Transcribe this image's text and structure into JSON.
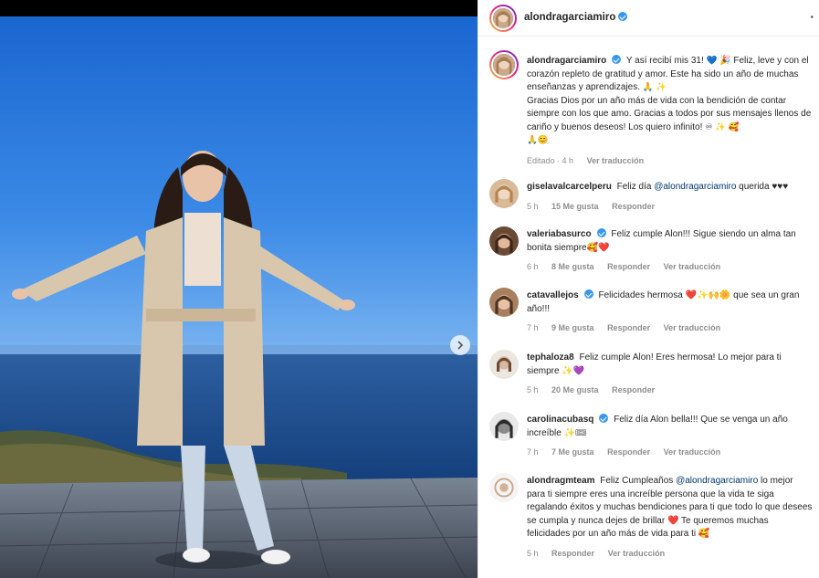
{
  "post": {
    "author": "alondragarciamiro",
    "more_label": "·",
    "caption_parts": [
      "Y así recibí mis 31! ",
      "💙",
      " 🎉 Feliz, leve y con el corazón repleto de gratitud y amor. Este ha sido un año de muchas enseñanzas y aprendizajes.",
      "🙏 ✨",
      "Gracias Dios por un año más de vida con la bendición de contar siempre con los que amo. Gracias a todos por sus mensajes llenos de cariño y buenos deseos! Los quiero infinito! ",
      "♾ ✨ 🥰",
      "🙏😊"
    ],
    "edited": "Editado · 4 h",
    "see_translation": "Ver traducción"
  },
  "comments": [
    {
      "user": "giselavalcarcelperu",
      "verified": false,
      "text_before": "Feliz día ",
      "mention": "@alondragarciamiro",
      "text_after": " querida ♥♥♥",
      "time": "5 h",
      "likes": "15 Me gusta",
      "reply": "Responder",
      "translate": ""
    },
    {
      "user": "valeriabasurco",
      "verified": true,
      "text_before": "Feliz cumple Alon!!! Sigue siendo un alma tan bonita siempre🥰❤️",
      "mention": "",
      "text_after": "",
      "time": "6 h",
      "likes": "8 Me gusta",
      "reply": "Responder",
      "translate": "Ver traducción"
    },
    {
      "user": "catavallejos",
      "verified": true,
      "text_before": "Felicidades hermosa ❤️✨🙌🌼 que sea un gran año!!!",
      "mention": "",
      "text_after": "",
      "time": "7 h",
      "likes": "9 Me gusta",
      "reply": "Responder",
      "translate": "Ver traducción"
    },
    {
      "user": "tephaloza8",
      "verified": false,
      "text_before": "Feliz cumple Alon! Eres hermosa! Lo mejor para ti siempre ✨💜",
      "mention": "",
      "text_after": "",
      "time": "5 h",
      "likes": "20 Me gusta",
      "reply": "Responder",
      "translate": ""
    },
    {
      "user": "carolinacubasq",
      "verified": true,
      "text_before": "Feliz día Alon bella!!! Que se venga un año increíble ✨🎟",
      "mention": "",
      "text_after": "",
      "time": "7 h",
      "likes": "7 Me gusta",
      "reply": "Responder",
      "translate": "Ver traducción"
    },
    {
      "user": "alondragmteam",
      "verified": false,
      "text_before": "Feliz Cumpleaños ",
      "mention": "@alondragarciamiro",
      "text_after": " lo mejor para ti siempre eres una increíble persona que la vida te siga regalando éxitos y muchas bendiciones para ti que todo lo que desees se cumpla y nunca dejes de brillar ❤️ Te queremos muchas felicidades por un año más de vida para ti 🥰",
      "time": "5 h",
      "likes": "",
      "reply": "Responder",
      "translate": "Ver traducción"
    }
  ],
  "colors": {
    "sky": "#1d72d8",
    "sea": "#1a4f94",
    "coat": "#d9c7ad",
    "verified": "#3897f0",
    "meta": "#8e8e8e"
  },
  "icons": {
    "next": "chevron-right-icon",
    "verified": "verified-badge-icon",
    "more": "more-options-icon"
  }
}
